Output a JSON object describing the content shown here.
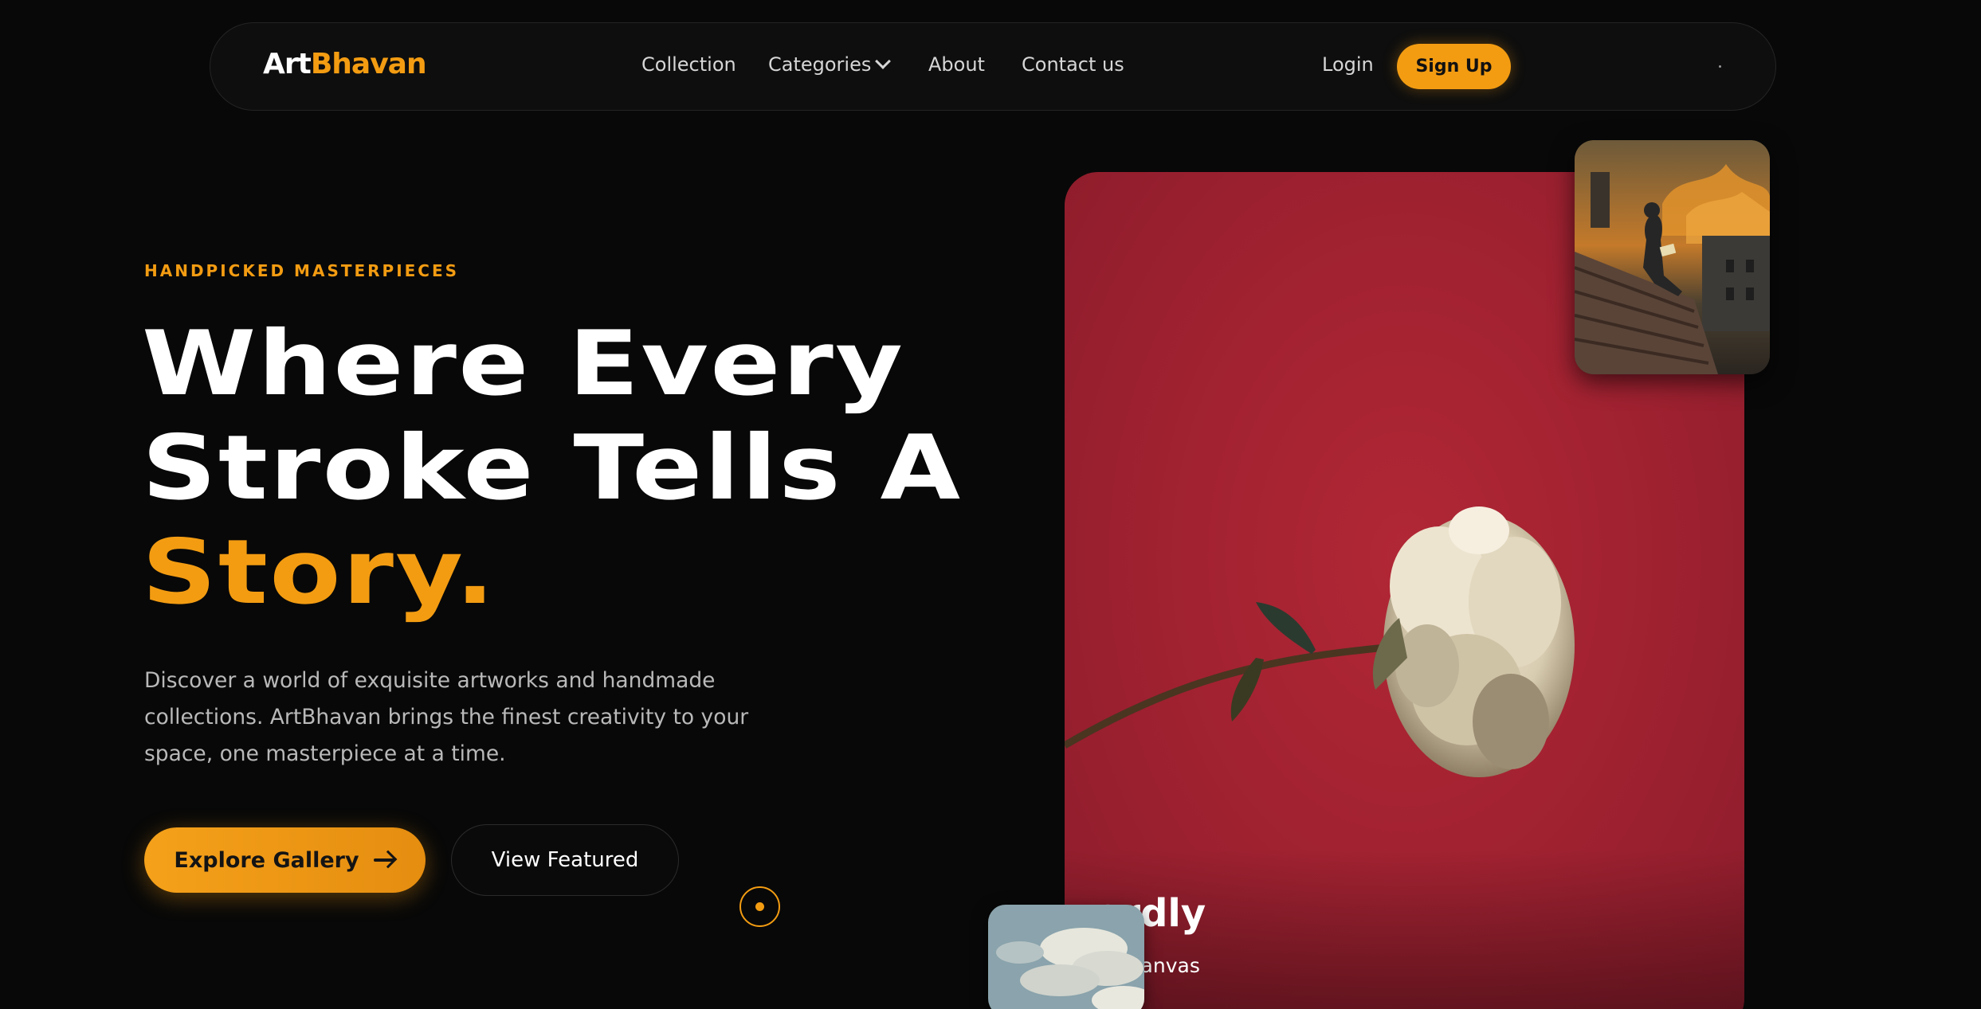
{
  "brand": {
    "part1": "Art",
    "part2": "Bhavan"
  },
  "nav": {
    "links": [
      "Collection",
      "Categories",
      "About",
      "Contact us"
    ],
    "login": "Login",
    "signup": "Sign Up"
  },
  "hero": {
    "eyebrow": "HANDPICKED MASTERPIECES",
    "headline_line1": "Where Every",
    "headline_line2": "Stroke Tells A",
    "headline_accent": "Story.",
    "description": "Discover a world of exquisite artworks and handmade collections. ArtBhavan brings the finest creativity to your space, one masterpiece at a time.",
    "primary_cta": "Explore Gallery",
    "secondary_cta": "View Featured"
  },
  "featured_art": {
    "title_visible": "ardly",
    "medium_visible": "on Canvas"
  },
  "icons": {
    "categories": "chevron-down-icon",
    "explore": "arrow-right-icon",
    "scroll": "scroll-indicator-icon"
  },
  "colors": {
    "accent": "#f39c12",
    "background": "#080808",
    "card": "#a22231"
  }
}
